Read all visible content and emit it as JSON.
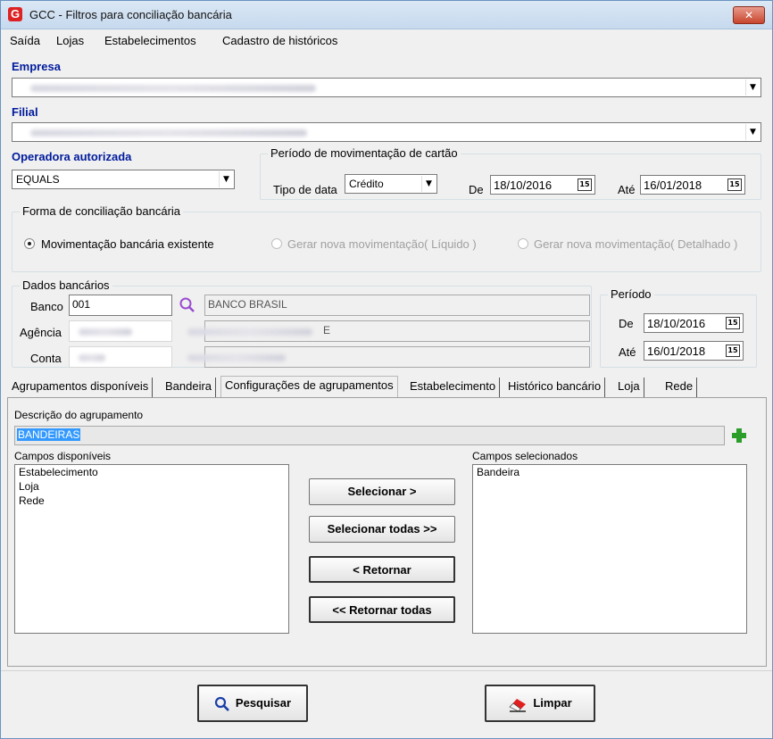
{
  "window": {
    "title": "GCC - Filtros para conciliação bancária",
    "app_icon": "G",
    "close_symbol": "✕"
  },
  "menu": [
    "Saída",
    "Lojas",
    "Estabelecimentos",
    "Cadastro de históricos"
  ],
  "empresa": {
    "label": "Empresa"
  },
  "filial": {
    "label": "Filial"
  },
  "operadora": {
    "label": "Operadora autorizada",
    "value": "EQUALS"
  },
  "periodo_mov": {
    "title": "Período de movimentação de cartão",
    "tipo_label": "Tipo de data",
    "tipo_value": "Crédito",
    "de_label": "De",
    "de_value": "18/10/2016",
    "ate_label": "Até",
    "ate_value": "16/01/2018"
  },
  "forma": {
    "title": "Forma de conciliação bancária",
    "options": [
      "Movimentação bancária existente",
      "Gerar nova movimentação( Líquido )",
      "Gerar nova movimentação( Detalhado )"
    ],
    "selected": "Movimentação bancária existente"
  },
  "dados": {
    "title": "Dados bancários",
    "banco_label": "Banco",
    "banco_code": "001",
    "banco_name": "BANCO BRASIL",
    "agencia_label": "Agência",
    "agencia_suffix": "E",
    "conta_label": "Conta"
  },
  "periodo": {
    "title": "Período",
    "de_label": "De",
    "de_value": "18/10/2016",
    "ate_label": "Até",
    "ate_value": "16/01/2018"
  },
  "tabs": [
    "Agrupamentos disponíveis",
    "Bandeira",
    "Configurações de agrupamentos",
    "Estabelecimento",
    "Histórico bancário",
    "Loja",
    "Rede"
  ],
  "active_tab": "Configurações de agrupamentos",
  "config": {
    "descricao_label": "Descrição do agrupamento",
    "descricao_value": "BANDEIRAS",
    "disponiveis_label": "Campos disponíveis",
    "disponiveis": [
      "Estabelecimento",
      "Loja",
      "Rede"
    ],
    "selecionados_label": "Campos selecionados",
    "selecionados": [
      "Bandeira"
    ],
    "btn_selecionar": "Selecionar >",
    "btn_selecionar_todas": "Selecionar todas >>",
    "btn_retornar": "< Retornar",
    "btn_retornar_todas": "<< Retornar todas"
  },
  "bottom": {
    "pesquisar": "Pesquisar",
    "limpar": "Limpar"
  },
  "calendar_glyph": "15",
  "dropdown_glyph": "▼",
  "colors": {
    "label_blue": "#001b9c",
    "selection_blue": "#3399ff",
    "plus_green": "#2a9d2a"
  }
}
